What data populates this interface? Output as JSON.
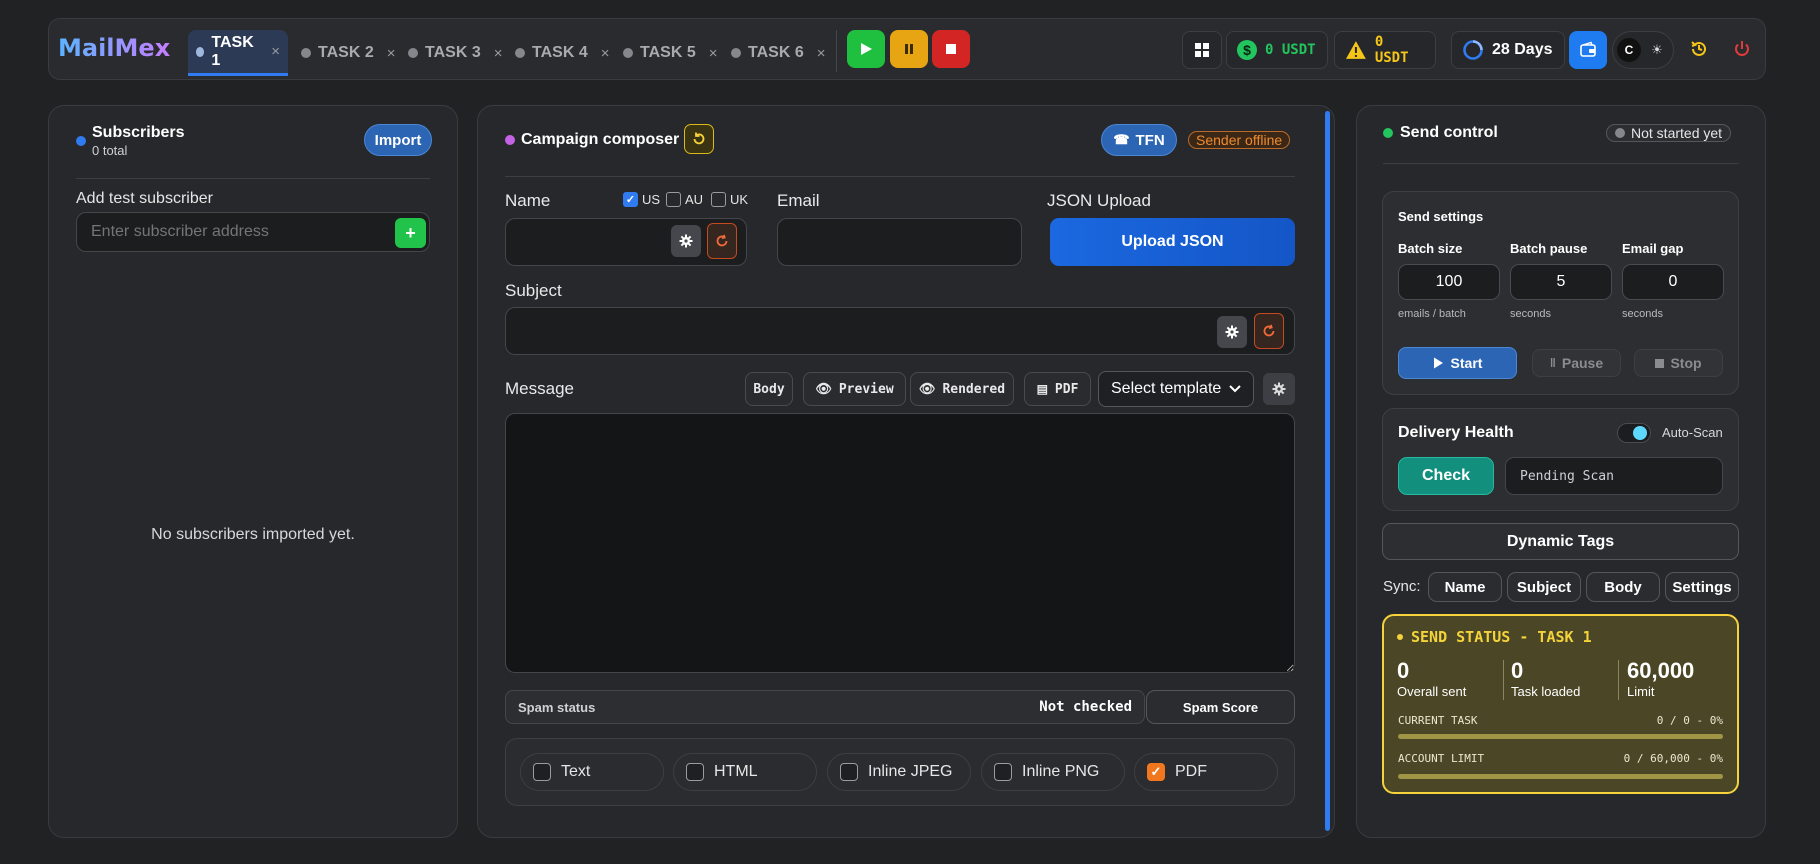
{
  "app": {
    "logo": "MailMex"
  },
  "tabs": [
    {
      "label": "TASK 1",
      "close": "×"
    },
    {
      "label": "TASK 2",
      "close": "×"
    },
    {
      "label": "TASK 3",
      "close": "×"
    },
    {
      "label": "TASK 4",
      "close": "×"
    },
    {
      "label": "TASK 5",
      "close": "×"
    },
    {
      "label": "TASK 6",
      "close": "×"
    }
  ],
  "header": {
    "balance1": "0 USDT",
    "balance2": "0 USDT",
    "days": "28 Days",
    "theme_dark": "C",
    "theme_light": "☀"
  },
  "subscribers": {
    "title": "Subscribers",
    "total": "0 total",
    "import_label": "Import",
    "add_label": "Add test subscriber",
    "placeholder": "Enter subscriber address",
    "add_btn": "+",
    "empty": "No subscribers imported yet."
  },
  "composer": {
    "title": "Campaign composer",
    "tfn_label": "TFN",
    "sender_status": "Sender offline",
    "name_label": "Name",
    "country_us": "US",
    "country_au": "AU",
    "country_uk": "UK",
    "email_label": "Email",
    "json_label": "JSON Upload",
    "upload_btn": "Upload JSON",
    "subject_label": "Subject",
    "message_label": "Message",
    "body_btn": "Body",
    "preview_btn": "Preview",
    "rendered_btn": "Rendered",
    "pdf_btn": "PDF",
    "template_select": "Select template",
    "spam_label": "Spam status",
    "spam_value": "Not checked",
    "spam_score_btn": "Spam Score",
    "formats": [
      {
        "label": "Text",
        "checked": false
      },
      {
        "label": "HTML",
        "checked": false
      },
      {
        "label": "Inline JPEG",
        "checked": false
      },
      {
        "label": "Inline PNG",
        "checked": false
      },
      {
        "label": "PDF",
        "checked": true
      }
    ]
  },
  "send_control": {
    "title": "Send control",
    "status": "Not started yet",
    "settings_title": "Send settings",
    "batch_size_label": "Batch size",
    "batch_size": "100",
    "batch_size_unit": "emails / batch",
    "batch_pause_label": "Batch pause",
    "batch_pause": "5",
    "batch_pause_unit": "seconds",
    "email_gap_label": "Email gap",
    "email_gap": "0",
    "email_gap_unit": "seconds",
    "start_btn": "Start",
    "pause_btn": "Pause",
    "stop_btn": "Stop",
    "health_title": "Delivery Health",
    "autoscan_label": "Auto-Scan",
    "check_btn": "Check",
    "scan_status": "Pending Scan",
    "dynamic_tags": "Dynamic Tags",
    "sync_label": "Sync:",
    "sync_name": "Name",
    "sync_subject": "Subject",
    "sync_body": "Body",
    "sync_settings": "Settings",
    "status_title": "SEND STATUS - TASK 1",
    "overall_sent": "0",
    "overall_sent_label": "Overall sent",
    "task_loaded": "0",
    "task_loaded_label": "Task loaded",
    "limit": "60,000",
    "limit_label": "Limit",
    "current_task_label": "CURRENT TASK",
    "current_task_value": "0 / 0 - 0%",
    "current_task_progress": 0,
    "account_limit_label": "ACCOUNT LIMIT",
    "account_limit_value": "0 / 60,000 - 0%",
    "account_limit_progress": 0
  },
  "colors": {
    "accent": "#2f7bef",
    "status_yellow": "#f5d33b",
    "green": "#22c55e",
    "orange": "#f08a2c"
  }
}
